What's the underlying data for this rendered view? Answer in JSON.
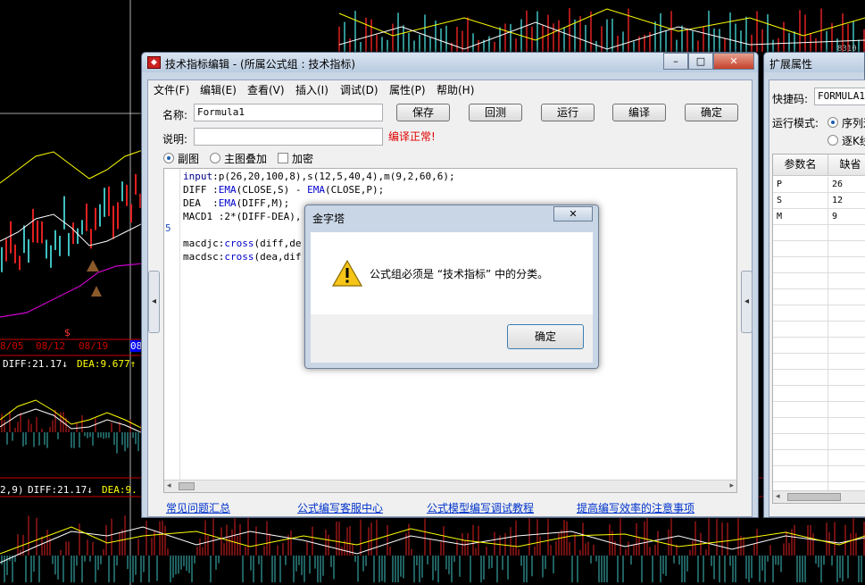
{
  "chart_overlay": {
    "dates": [
      "8/05",
      "08/12",
      "08/19",
      "08"
    ],
    "diff_top": "DIFF:21.17↓",
    "dea_top": "DEA:9.677↑",
    "params_bottom": "2,9)",
    "diff_bottom": "DIFF:21.17↓",
    "dea_bottom": "DEA:9.",
    "price_marker": "8310"
  },
  "editor_window": {
    "title": "技术指标编辑 - (所属公式组 : 技术指标)",
    "caption_buttons": {
      "minimize": "–",
      "maximize": "□",
      "close": "✕"
    },
    "menu": [
      "文件(F)",
      "编辑(E)",
      "查看(V)",
      "插入(I)",
      "调试(D)",
      "属性(P)",
      "帮助(H)"
    ],
    "name_label": "名称:",
    "name_value": "Formula1",
    "desc_label": "说明:",
    "desc_value": "",
    "status": "编译正常!",
    "buttons": {
      "save": "保存",
      "backtest": "回测",
      "run": "运行",
      "compile": "编译",
      "ok": "确定"
    },
    "options": {
      "sub_chart": "副图",
      "main_overlay": "主图叠加",
      "encrypt": "加密"
    },
    "gutter_marker": "5",
    "code": {
      "line1": {
        "kw": "input",
        "rest": ":p(26,20,100,8),s(12,5,40,4),m(9,2,60,6);"
      },
      "line2": {
        "name": "DIFF :",
        "f1": "EMA",
        "a1": "(CLOSE,S) - ",
        "f2": "EMA",
        "a2": "(CLOSE,P);"
      },
      "line3": {
        "name": "DEA  :",
        "f1": "EMA",
        "a1": "(DIFF,M);"
      },
      "line4": {
        "text": "MACD1 :2*(DIFF-DEA),"
      },
      "line5": {
        "name": "macdjc:",
        "f": "cross",
        "a": "(diff,de"
      },
      "line6": {
        "name": "macdsc:",
        "f": "cross",
        "a": "(dea,dif"
      }
    },
    "links": [
      "常见问题汇总",
      "公式编写客服中心",
      "公式模型编写调试教程",
      "提高编写效率的注意事项"
    ]
  },
  "dialog": {
    "title": "金字塔",
    "close": "✕",
    "message": "公式组必须是 “技术指标” 中的分类。",
    "ok": "确定"
  },
  "ext_panel": {
    "title": "扩展属性",
    "shortcut_label": "快捷码:",
    "shortcut_value": "FORMULA1",
    "mode_label": "运行模式:",
    "mode_options": [
      "序列运",
      "逐K线"
    ],
    "table_headers": [
      "参数名",
      "缺省"
    ],
    "rows": [
      {
        "name": "P",
        "default": "26"
      },
      {
        "name": "S",
        "default": "12"
      },
      {
        "name": "M",
        "default": "9"
      }
    ]
  },
  "colors": {
    "title_bg": "#c9d6e6",
    "status_red": "#e00000",
    "link_blue": "#0033cc"
  }
}
